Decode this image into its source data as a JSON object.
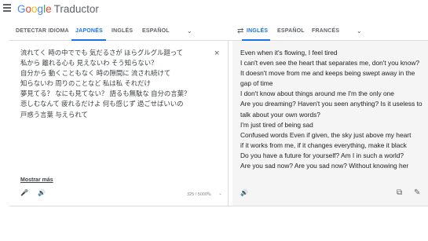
{
  "header": {
    "brand": [
      "G",
      "o",
      "o",
      "g",
      "l",
      "e"
    ],
    "product": "Traductor"
  },
  "source_langs": {
    "detect": "DETECTAR IDIOMA",
    "selected": "JAPONÉS",
    "l2": "INGLÉS",
    "l3": "ESPAÑOL"
  },
  "target_langs": {
    "selected": "INGLÉS",
    "l2": "ESPAÑOL",
    "l3": "FRANCÉS"
  },
  "source": {
    "lines": [
      "流れてく 時の中ででも 気だるさが ほらグルグル廻って",
      "私から 離れる心も 見えないわ そう知らない？",
      "自分から 動くこともなく 時の隙間に 流され続けて",
      "知らないわ 周りのことなど 私は私 それだけ",
      "夢見てる？ なにも見てない？ 語るも無駄な 自分の言葉？",
      "悲しむなんて 疲れるだけよ 何も感じず 過ごせばいいの",
      "戸惑う言葉 与えられて"
    ],
    "more_link": "Mostrar más",
    "char_count": "325 / 5000"
  },
  "target": {
    "lines": [
      "Even when it's flowing, I feel tired",
      "I can't even see the heart that separates me, don't you know?",
      "It doesn't move from me and keeps being swept away in the",
      "gap of time",
      "I don't know about things around me I'm the only one",
      "Are you dreaming? Haven't you seen anything? Is it useless to",
      "talk about your own words?",
      "I'm just tired of being sad",
      "Confused words Even if given, the sky just above my heart",
      "if it works from me, if it changes everything, make it black",
      "Do you have a future for yourself? Am I in such a world?",
      "Are you sad now? Are you sad now? Without knowing her"
    ]
  },
  "icons": {
    "menu": "≡",
    "chevron": "⌄",
    "swap": "⇄",
    "clear": "×",
    "mic": "🎤",
    "speaker": "🔊",
    "copy": "⧉",
    "edit": "✎"
  }
}
